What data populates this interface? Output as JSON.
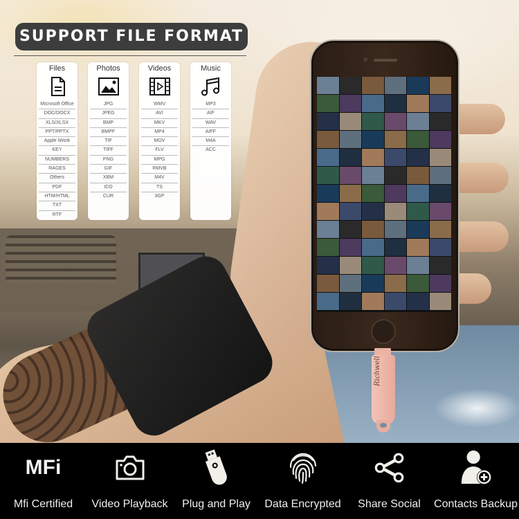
{
  "header": {
    "title": "SUPPORT FILE FORMAT"
  },
  "format_columns": [
    {
      "title": "Files",
      "icon": "document-icon",
      "items": [
        "Microsoft Office",
        "DOC/DOCX",
        "XLS/XLSX",
        "PPT/PPTX",
        "Apple iWork",
        "KEY",
        "NUMBERS",
        "RAGES",
        "Others",
        "PDF",
        "HTM/HTML",
        "TXT",
        "RTF"
      ]
    },
    {
      "title": "Photos",
      "icon": "image-icon",
      "items": [
        "JPG",
        "JPEG",
        "BMP",
        "BMPF",
        "TIF",
        "TIFF",
        "PNG",
        "GIF",
        "XBM",
        "ICO",
        "CUR"
      ]
    },
    {
      "title": "Videos",
      "icon": "film-play-icon",
      "items": [
        "WMV",
        "AVI",
        "MKV",
        "MP4",
        "MOV",
        "FLV",
        "MPG",
        "RMVB",
        "M4V",
        "TS",
        "3GP"
      ]
    },
    {
      "title": "Music",
      "icon": "music-note-icon",
      "items": [
        "MP3",
        "AIF",
        "WAV",
        "AIFF",
        "M4A",
        "ACC"
      ]
    }
  ],
  "product": {
    "brand": "Richwell"
  },
  "features": [
    {
      "icon": "mfi-badge-icon",
      "icon_text": "MFi",
      "label": "Mfi Certified"
    },
    {
      "icon": "camera-icon",
      "label": "Video Playback"
    },
    {
      "icon": "usb-drive-icon",
      "label": "Plug and Play"
    },
    {
      "icon": "fingerprint-icon",
      "label": "Data Encrypted"
    },
    {
      "icon": "share-icon",
      "label": "Share Social"
    },
    {
      "icon": "contact-add-icon",
      "label": "Contacts Backup"
    }
  ],
  "colors": {
    "title_bg": "#3d3d3d",
    "footer_bg": "#000000",
    "usb_pink": "#f2c4b7"
  }
}
